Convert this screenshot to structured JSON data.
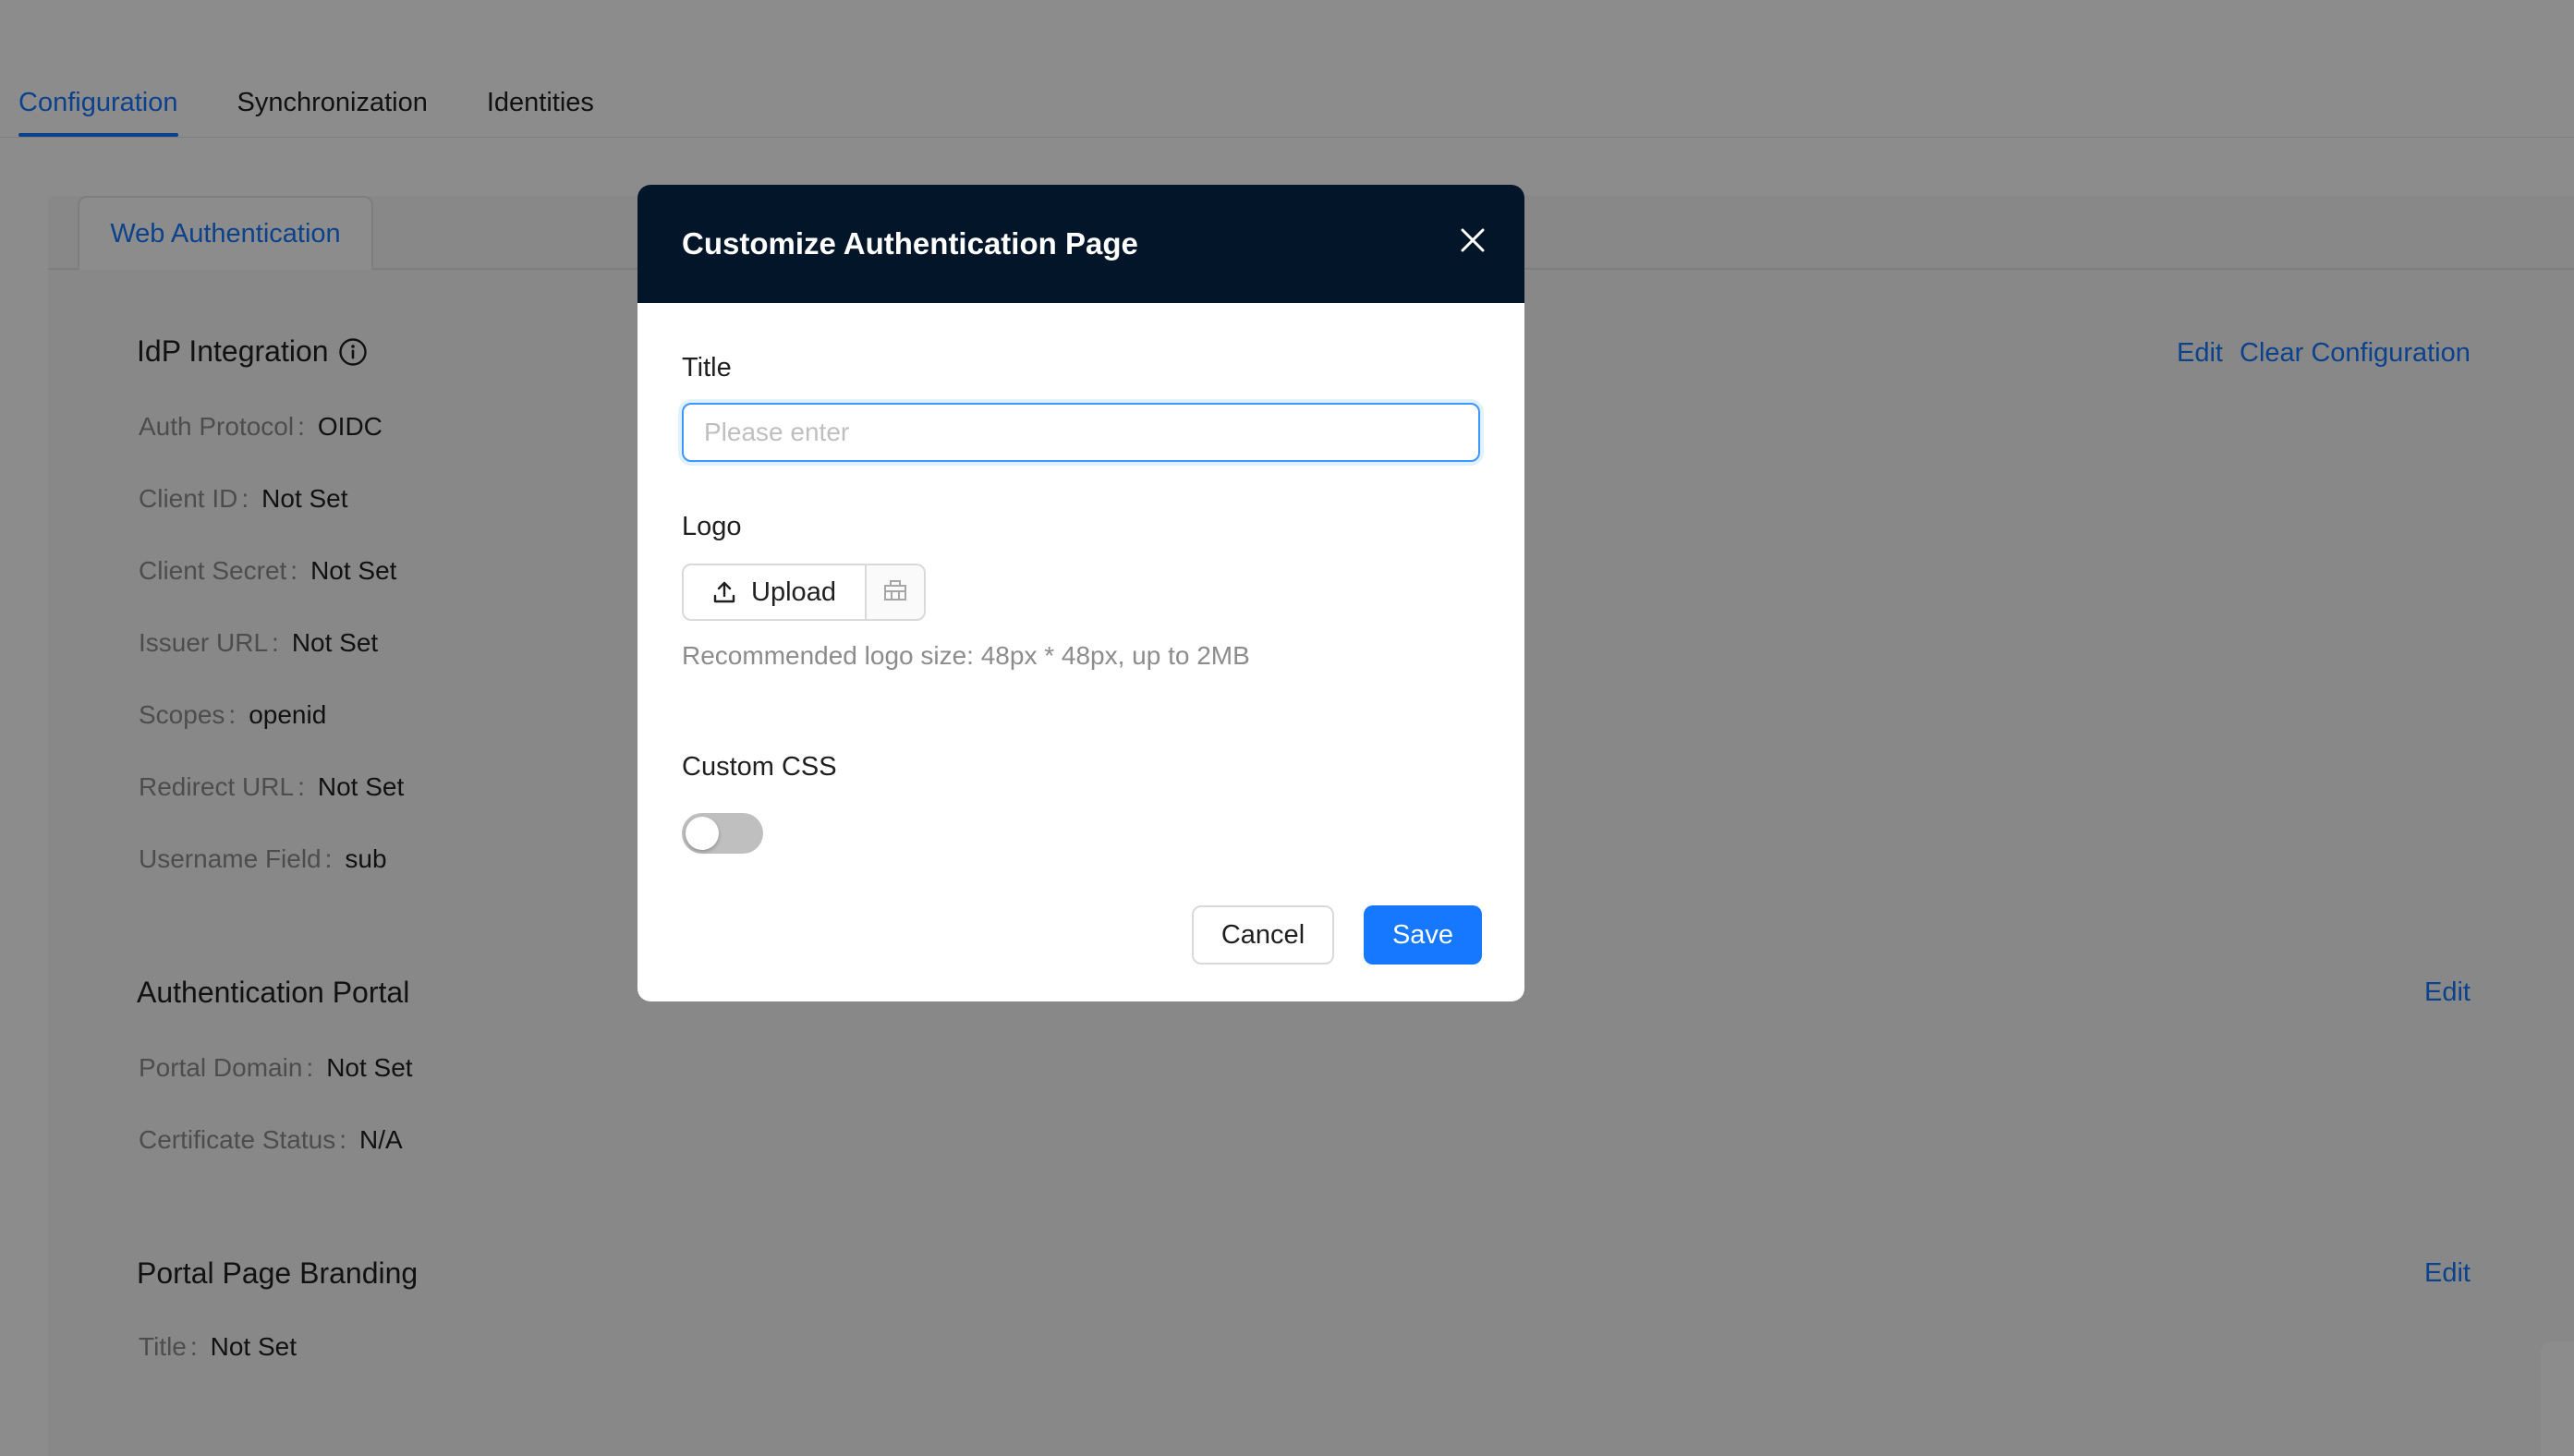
{
  "tabs": [
    {
      "label": "Configuration",
      "active": true
    },
    {
      "label": "Synchronization",
      "active": false
    },
    {
      "label": "Identities",
      "active": false
    }
  ],
  "subtab": {
    "label": "Web Authentication"
  },
  "idp": {
    "title": "IdP Integration",
    "edit": "Edit",
    "clear": "Clear Configuration",
    "rows": [
      {
        "key": "Auth Protocol",
        "value": "OIDC"
      },
      {
        "key": "Client ID",
        "value": "Not Set"
      },
      {
        "key": "Client Secret",
        "value": "Not Set"
      },
      {
        "key": "Issuer URL",
        "value": "Not Set"
      },
      {
        "key": "Scopes",
        "value": "openid"
      },
      {
        "key": "Redirect URL",
        "value": "Not Set"
      },
      {
        "key": "Username Field",
        "value": "sub"
      }
    ]
  },
  "portal": {
    "title": "Authentication Portal",
    "edit": "Edit",
    "rows": [
      {
        "key": "Portal Domain",
        "value": "Not Set"
      },
      {
        "key": "Certificate Status",
        "value": "N/A"
      }
    ]
  },
  "branding": {
    "title": "Portal Page Branding",
    "edit": "Edit",
    "rows": [
      {
        "key": "Title",
        "value": "Not Set"
      }
    ]
  },
  "colon": ":",
  "modal": {
    "title": "Customize Authentication Page",
    "title_label": "Title",
    "title_value": "",
    "title_placeholder": "Please enter",
    "logo_label": "Logo",
    "upload_label": "Upload",
    "logo_hint": "Recommended logo size: 48px * 48px, up to 2MB",
    "css_label": "Custom CSS",
    "css_enabled": false,
    "cancel": "Cancel",
    "save": "Save"
  },
  "colors": {
    "accent": "#1677ff",
    "modal_header": "#031529"
  }
}
